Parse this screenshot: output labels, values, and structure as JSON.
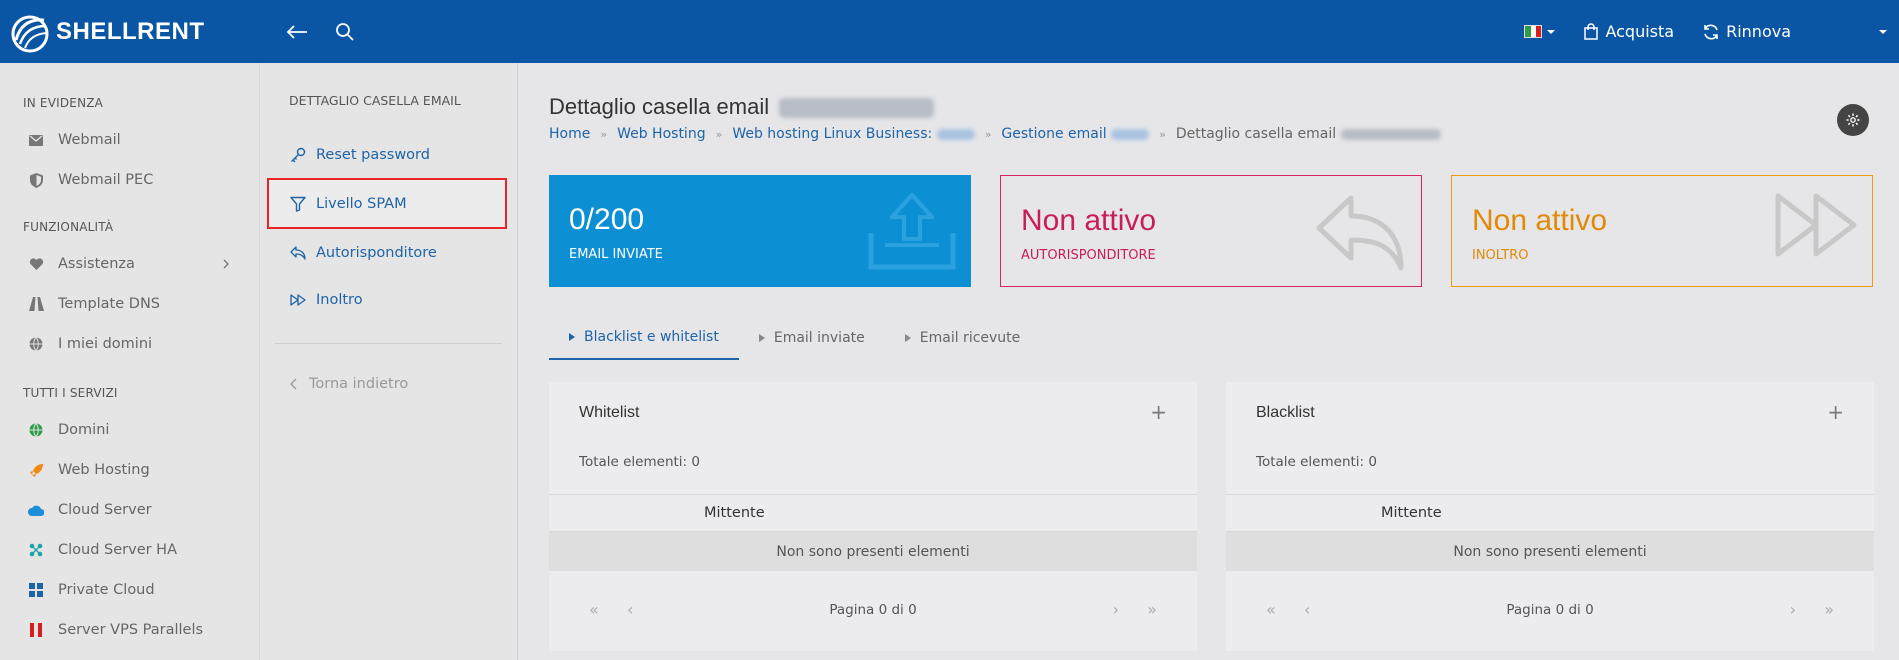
{
  "topbar": {
    "brand": "SHELLRENT",
    "acquista": "Acquista",
    "rinnova": "Rinnova",
    "icons": [
      "back-arrow-icon",
      "search-icon",
      "italy-flag-icon",
      "shopping-bag-icon",
      "refresh-icon"
    ]
  },
  "sidebar": {
    "sections": [
      {
        "title": "IN EVIDENZA",
        "items": [
          {
            "label": "Webmail",
            "icon": "envelope-icon"
          },
          {
            "label": "Webmail PEC",
            "icon": "shield-icon"
          }
        ]
      },
      {
        "title": "FUNZIONALITÀ",
        "items": [
          {
            "label": "Assistenza",
            "icon": "heart-hands-icon"
          },
          {
            "label": "Template DNS",
            "icon": "road-icon"
          },
          {
            "label": "I miei domini",
            "icon": "globe-icon"
          }
        ]
      },
      {
        "title": "TUTTI I SERVIZI",
        "items": [
          {
            "label": "Domini",
            "icon": "globe-green-icon",
            "color": "#2e9b47"
          },
          {
            "label": "Web Hosting",
            "icon": "rocket-icon",
            "color": "#ef8a16"
          },
          {
            "label": "Cloud Server",
            "icon": "cloud-icon",
            "color": "#1d8fd8"
          },
          {
            "label": "Cloud Server HA",
            "icon": "network-icon",
            "color": "#1aa6a8"
          },
          {
            "label": "Private Cloud",
            "icon": "grid-icon",
            "color": "#1d64a8"
          },
          {
            "label": "Server VPS Parallels",
            "icon": "parallels-icon",
            "color": "#d42020"
          }
        ]
      }
    ]
  },
  "submenu": {
    "title": "DETTAGLIO CASELLA EMAIL",
    "items": [
      {
        "label": "Reset password",
        "icon": "key-icon"
      },
      {
        "label": "Livello SPAM",
        "icon": "filter-icon"
      },
      {
        "label": "Autorisponditore",
        "icon": "reply-icon"
      },
      {
        "label": "Inoltro",
        "icon": "forward-icon"
      }
    ],
    "back": "Torna indietro"
  },
  "main": {
    "title": "Dettaglio casella email",
    "breadcrumb": [
      "Home",
      "Web Hosting",
      "Web hosting Linux Business:",
      "Gestione email",
      "Dettaglio casella email"
    ],
    "stats": [
      {
        "value": "0/200",
        "label": "EMAIL INVIATE",
        "color": "#0d8fd4"
      },
      {
        "value": "Non attivo",
        "label": "AUTORISPONDITORE",
        "color": "#c91d58"
      },
      {
        "value": "Non attivo",
        "label": "INOLTRO",
        "color": "#e08a07"
      }
    ],
    "tabs": [
      "Blacklist e whitelist",
      "Email inviate",
      "Email ricevute"
    ],
    "panels": [
      {
        "title": "Whitelist",
        "total": "Totale elementi: 0",
        "column": "Mittente",
        "empty": "Non sono presenti elementi",
        "pager": "Pagina 0 di 0"
      },
      {
        "title": "Blacklist",
        "total": "Totale elementi: 0",
        "column": "Mittente",
        "empty": "Non sono presenti elementi",
        "pager": "Pagina 0 di 0"
      }
    ]
  }
}
